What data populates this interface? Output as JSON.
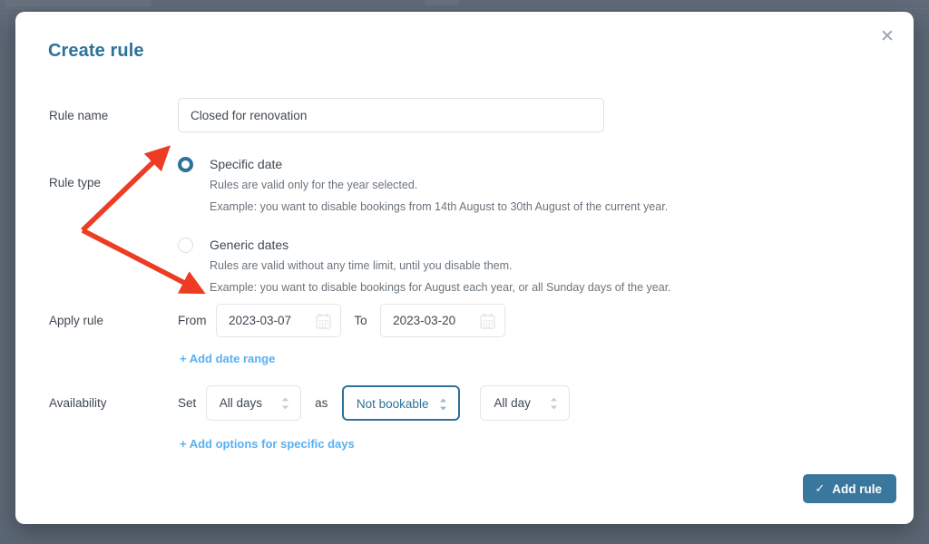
{
  "modal": {
    "title": "Create rule",
    "close_icon": "close-icon"
  },
  "fields": {
    "rule_name": {
      "label": "Rule name",
      "value": "Closed for renovation",
      "placeholder": "Rule name"
    },
    "rule_type": {
      "label": "Rule type",
      "options": [
        {
          "title": "Specific date",
          "line1": "Rules are valid only for the year selected.",
          "line2": "Example: you want to disable bookings from 14th August to 30th August of the current year.",
          "selected": true
        },
        {
          "title": "Generic dates",
          "line1": "Rules are valid without any time limit, until you disable them.",
          "line2": "Example: you want to disable bookings for August each year, or all Sunday days of the year.",
          "selected": false
        }
      ]
    },
    "apply_rule": {
      "label": "Apply rule",
      "from_word": "From",
      "from_value": "2023-03-07",
      "to_word": "To",
      "to_value": "2023-03-20",
      "add_range_link": "+ Add date range",
      "calendar_icon": "calendar-icon"
    },
    "availability": {
      "label": "Availability",
      "set_word": "Set",
      "days_value": "All days",
      "as_word": "as",
      "state_value": "Not bookable",
      "time_value": "All day",
      "add_options_link": "+ Add options for specific days",
      "stepper_icon": "stepper-updown-icon"
    }
  },
  "footer": {
    "add_rule_label": "Add rule",
    "add_rule_icon": "check-icon"
  },
  "colors": {
    "accent": "#2e7299",
    "link": "#59b0f0",
    "button": "#39779c",
    "annotation": "#ee3b24",
    "backdrop": "#5c6775"
  }
}
